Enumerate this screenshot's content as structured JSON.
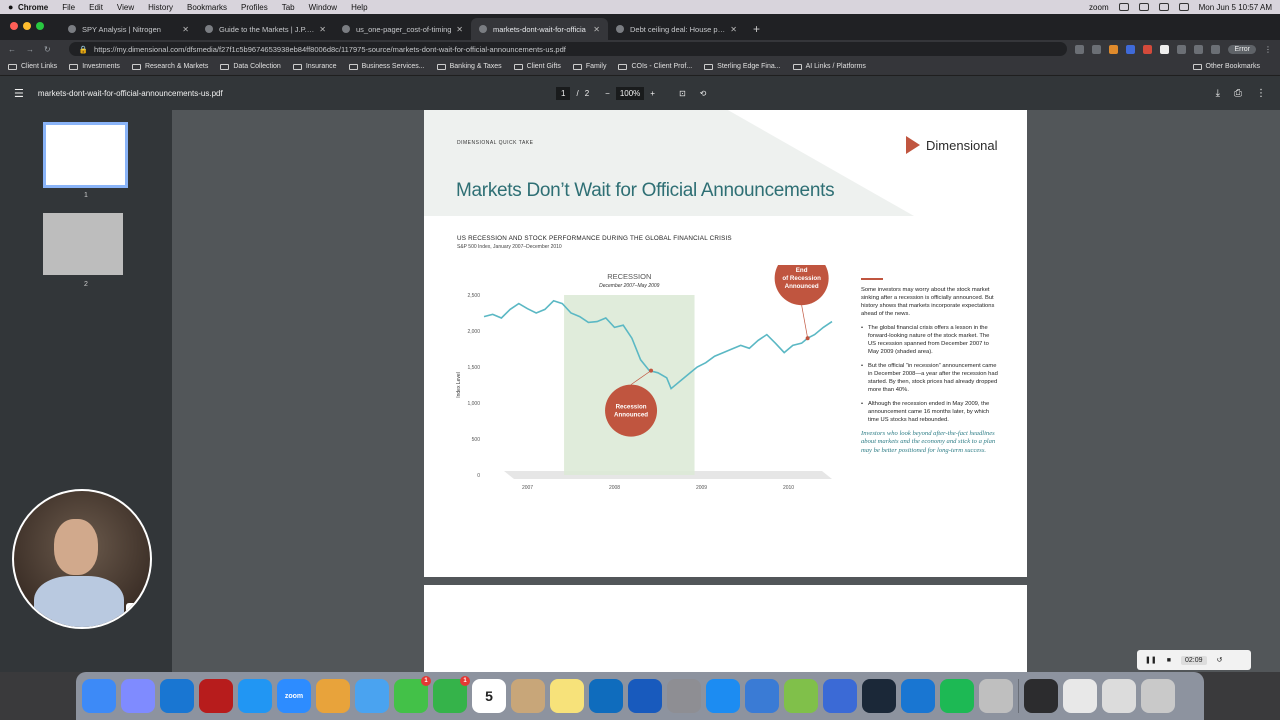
{
  "menubar": {
    "app": "Chrome",
    "items": [
      "File",
      "Edit",
      "View",
      "History",
      "Bookmarks",
      "Profiles",
      "Tab",
      "Window",
      "Help"
    ],
    "zoom_label": "zoom",
    "clock": "Mon Jun 5  10:57 AM"
  },
  "tabs": [
    {
      "label": "SPY Analysis | Nitrogen",
      "active": false
    },
    {
      "label": "Guide to the Markets | J.P. Mo",
      "active": false
    },
    {
      "label": "us_one-pager_cost-of-timing",
      "active": false
    },
    {
      "label": "markets-dont-wait-for-officia",
      "active": true
    },
    {
      "label": "Debt ceiling deal: House pass",
      "active": false
    }
  ],
  "address": {
    "url": "https://my.dimensional.com/dfsmedia/f27f1c5b9674653938eb84ff8006d8c/117975-source/markets-dont-wait-for-official-announcements-us.pdf",
    "error_label": "Error"
  },
  "bookmarks": {
    "items": [
      "Client Links",
      "Investments",
      "Research & Markets",
      "Data Collection",
      "Insurance",
      "Business Services...",
      "Banking & Taxes",
      "Client Gifts",
      "Family",
      "COIs - Client Prof...",
      "Sterling Edge Fina...",
      "AI Links / Platforms"
    ],
    "other": "Other Bookmarks"
  },
  "pdf": {
    "filename": "markets-dont-wait-for-official-announcements-us.pdf",
    "page_current": "1",
    "page_sep": "/",
    "page_total": "2",
    "zoom": "100%",
    "thumb_labels": [
      "1",
      "2"
    ]
  },
  "doc": {
    "kicker": "DIMENSIONAL QUICK TAKE",
    "logo": "Dimensional",
    "title": "Markets Don’t Wait for Official Announcements",
    "chart_title": "US RECESSION AND STOCK PERFORMANCE DURING THE GLOBAL FINANCIAL CRISIS",
    "chart_subtitle": "S&P 500 Index, January 2007–December 2010",
    "intro": "Some investors may worry about the stock market sinking after a recession is officially announced. But history shows that markets incorporate expectations ahead of the news.",
    "bullets": [
      "The global financial crisis offers a lesson in the forward-looking nature of the stock market. The US recession spanned from December 2007 to May 2009 (shaded area).",
      "But the official “in recession” announcement came in December 2008—a year after the recession had started. By then, stock prices had already dropped more than 40%.",
      "Although the recession ended in May 2009, the announcement came 16 months later, by which time US stocks had rebounded."
    ],
    "quote": "Investors who look beyond after-the-fact headlines about markets and the economy and stick to a plan may be better positioned for long-term success."
  },
  "chart_data": {
    "type": "line",
    "title": "US RECESSION AND STOCK PERFORMANCE DURING THE GLOBAL FINANCIAL CRISIS",
    "subtitle": "S&P 500 Index, January 2007–December 2010",
    "ylabel": "Index Level",
    "xlabel": "",
    "ylim": [
      0,
      2500
    ],
    "xlim": [
      2007.0,
      2011.0
    ],
    "yticks": [
      "0",
      "500",
      "1,000",
      "1,500",
      "2,000",
      "2,500"
    ],
    "yticks_values": [
      0,
      500,
      1000,
      1500,
      2000,
      2500
    ],
    "xticks": [
      "2007",
      "2008",
      "2009",
      "2010"
    ],
    "xticks_values": [
      2007.5,
      2008.5,
      2009.5,
      2010.5
    ],
    "shaded_region": {
      "label": "RECESSION",
      "sublabel": "December 2007–May 2009",
      "start": 2007.92,
      "end": 2009.42
    },
    "annotations": [
      {
        "text": "Recession Announced",
        "x": 2008.92,
        "y": 1450
      },
      {
        "text": "End of Recession Announced",
        "x": 2010.72,
        "y": 1900
      }
    ],
    "series": [
      {
        "name": "",
        "color": "#5bb8c4",
        "points": [
          [
            2007.0,
            2200
          ],
          [
            2007.1,
            2230
          ],
          [
            2007.2,
            2180
          ],
          [
            2007.3,
            2300
          ],
          [
            2007.4,
            2380
          ],
          [
            2007.5,
            2310
          ],
          [
            2007.6,
            2250
          ],
          [
            2007.7,
            2300
          ],
          [
            2007.8,
            2420
          ],
          [
            2007.9,
            2380
          ],
          [
            2008.0,
            2250
          ],
          [
            2008.1,
            2200
          ],
          [
            2008.2,
            2120
          ],
          [
            2008.3,
            2130
          ],
          [
            2008.4,
            2180
          ],
          [
            2008.5,
            2050
          ],
          [
            2008.6,
            2080
          ],
          [
            2008.7,
            1900
          ],
          [
            2008.8,
            1600
          ],
          [
            2008.9,
            1450
          ],
          [
            2009.0,
            1420
          ],
          [
            2009.1,
            1350
          ],
          [
            2009.15,
            1200
          ],
          [
            2009.25,
            1300
          ],
          [
            2009.35,
            1400
          ],
          [
            2009.45,
            1500
          ],
          [
            2009.55,
            1560
          ],
          [
            2009.65,
            1650
          ],
          [
            2009.75,
            1700
          ],
          [
            2009.85,
            1750
          ],
          [
            2009.95,
            1800
          ],
          [
            2010.05,
            1760
          ],
          [
            2010.15,
            1870
          ],
          [
            2010.25,
            1950
          ],
          [
            2010.35,
            1830
          ],
          [
            2010.45,
            1700
          ],
          [
            2010.55,
            1800
          ],
          [
            2010.65,
            1830
          ],
          [
            2010.72,
            1900
          ],
          [
            2010.8,
            1950
          ],
          [
            2010.9,
            2050
          ],
          [
            2011.0,
            2130
          ]
        ]
      }
    ],
    "grid": false,
    "legend": "none"
  },
  "recorder": {
    "time": "02:09"
  },
  "dock": {
    "apps": [
      {
        "name": "finder",
        "color": "#3d8af7"
      },
      {
        "name": "launchpad",
        "color": "#7f8bff"
      },
      {
        "name": "onedrive",
        "color": "#1976d2"
      },
      {
        "name": "filezilla",
        "color": "#b71c1c"
      },
      {
        "name": "safari",
        "color": "#2196f3"
      },
      {
        "name": "zoom",
        "color": "#2d8cff",
        "label": "zoom"
      },
      {
        "name": "chrome",
        "color": "#e8a33b"
      },
      {
        "name": "mail",
        "color": "#4aa3f0"
      },
      {
        "name": "messages",
        "color": "#43c148",
        "badge": "1"
      },
      {
        "name": "facetime",
        "color": "#35b34a",
        "badge": "1"
      },
      {
        "name": "calendar",
        "color": "#ffffff",
        "label": "5"
      },
      {
        "name": "contacts",
        "color": "#c8a679"
      },
      {
        "name": "notes",
        "color": "#f7e27a"
      },
      {
        "name": "outlook",
        "color": "#0f6cbd"
      },
      {
        "name": "word",
        "color": "#185abd"
      },
      {
        "name": "settings",
        "color": "#8e8e93"
      },
      {
        "name": "appstore",
        "color": "#1c8cf2"
      },
      {
        "name": "screens",
        "color": "#3a7bd5"
      },
      {
        "name": "android",
        "color": "#80c04a"
      },
      {
        "name": "photo",
        "color": "#3b6ad6"
      },
      {
        "name": "steam",
        "color": "#1b2838"
      },
      {
        "name": "remote",
        "color": "#1976d2"
      },
      {
        "name": "spotify",
        "color": "#1db954"
      },
      {
        "name": "preview",
        "color": "#bfbfbf"
      },
      {
        "name": "window1",
        "color": "#2c2c2e"
      },
      {
        "name": "window2",
        "color": "#e8e8e8"
      },
      {
        "name": "window3",
        "color": "#dcdcdc"
      },
      {
        "name": "trash",
        "color": "#c9c9c9"
      }
    ]
  }
}
